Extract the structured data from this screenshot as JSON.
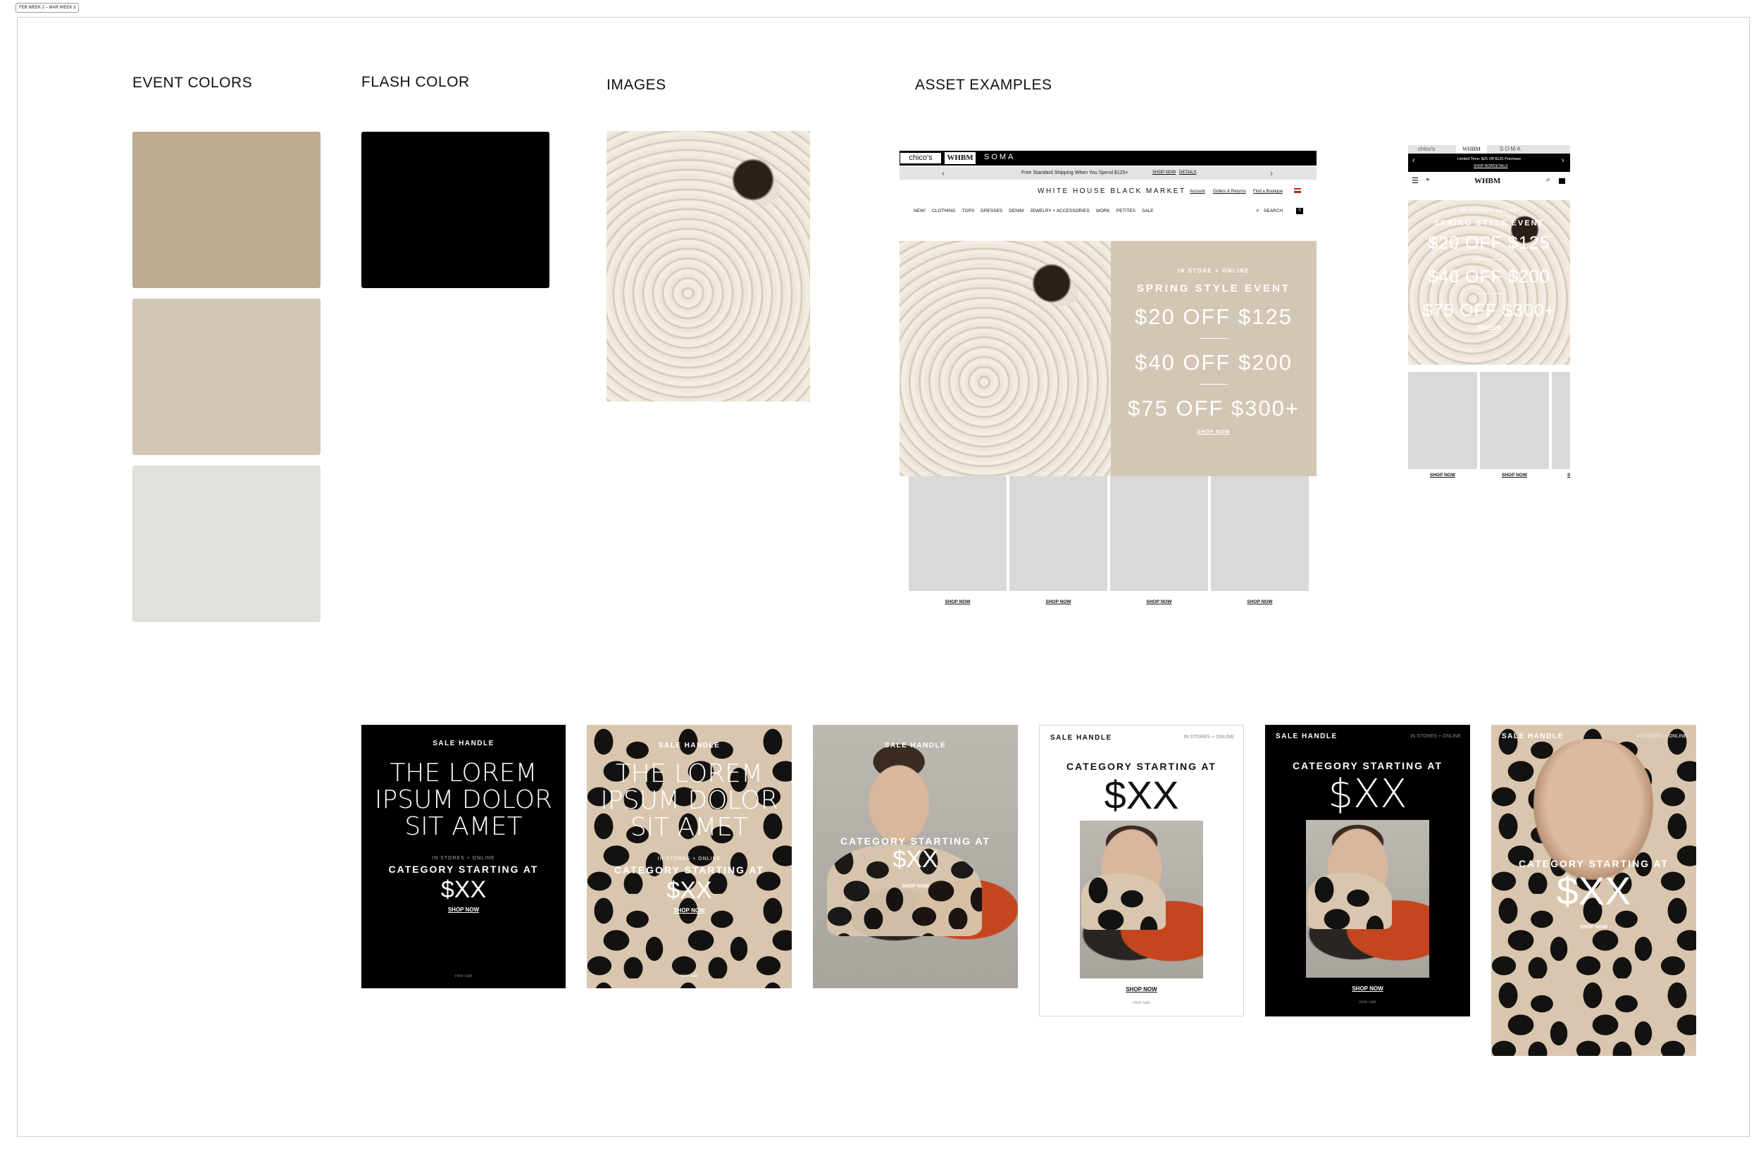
{
  "frame_label": "FEB WEEK 2 – MAR WEEK 3",
  "headings": {
    "event_colors": "EVENT COLORS",
    "flash_color": "FLASH COLOR",
    "images": "IMAGES",
    "asset_examples": "ASSET EXAMPLES"
  },
  "colors": {
    "event": [
      "#BEAB92",
      "#D4C6B4",
      "#E0E0DC"
    ],
    "flash": "#000000"
  },
  "desktop": {
    "brand_tabs": [
      "chico's",
      "WHBM",
      "SOMA"
    ],
    "promo_bar": "Free Standard Shipping When You Spend $125+",
    "promo_links": [
      "SHOP NOW",
      "DETAILS"
    ],
    "logo": "WHITE HOUSE BLACK MARKET",
    "util_links": [
      "Account",
      "Orders & Returns",
      "Find a Boutique"
    ],
    "nav": [
      "NEW!",
      "CLOTHING",
      "TOPS",
      "DRESSES",
      "DENIM",
      "JEWELRY + ACCESSORIES",
      "WORK",
      "PETITES",
      "SALE"
    ],
    "search": "SEARCH",
    "cart_count": "0",
    "hero": {
      "eyebrow": "IN STORE + ONLINE",
      "title": "SPRING STYLE EVENT",
      "offers": [
        "$20 OFF $125",
        "$40 OFF $200",
        "$75 OFF $300+"
      ],
      "cta": "SHOP NOW"
    },
    "tiles_cta": [
      "SHOP NOW",
      "SHOP NOW",
      "SHOP NOW",
      "SHOP NOW"
    ]
  },
  "mobile": {
    "brand_tabs": [
      "chico's",
      "WHBM",
      "SOMA"
    ],
    "promo_bar": "Limited Time: $25 Off $125 Purchase",
    "promo_links": [
      "SHOP NOW",
      "DETAILS"
    ],
    "logo": "WHBM",
    "hero": {
      "eyebrow": "IN STORE + ONLINE",
      "title": "SPRING STYLE EVENT",
      "offers": [
        "$20 OFF $125",
        "$40 OFF $200",
        "$75 OFF $300+"
      ],
      "cta": "SHOP NOW"
    },
    "tiles_cta": [
      "SHOP NOW",
      "SHOP NOW",
      "S"
    ]
  },
  "cards": [
    {
      "handle": "SALE HANDLE",
      "headline": [
        "THE LOREM",
        "IPSUM DOLOR",
        "SIT AMET"
      ],
      "eyebrow": "IN STORES + ONLINE",
      "category": "CATEGORY STARTING AT",
      "price": "$XX",
      "cta": "SHOP NOW",
      "fine": "view sale"
    },
    {
      "handle": "SALE HANDLE",
      "headline": [
        "THE LOREM",
        "IPSUM DOLOR",
        "SIT AMET"
      ],
      "eyebrow": "IN STORES + ONLINE",
      "category": "CATEGORY STARTING AT",
      "price": "$XX",
      "cta": "SHOP NOW",
      "fine": "view sale"
    },
    {
      "handle": "SALE HANDLE",
      "category": "CATEGORY STARTING AT",
      "price": "$XX",
      "cta": "SHOP NOW"
    },
    {
      "handle": "SALE HANDLE",
      "meta": "IN STORES + ONLINE",
      "category": "CATEGORY STARTING AT",
      "price": "$XX",
      "cta": "SHOP NOW",
      "fine": "view sale"
    },
    {
      "handle": "SALE HANDLE",
      "meta": "IN STORES + ONLINE",
      "category": "CATEGORY STARTING AT",
      "price": "$XX",
      "cta": "SHOP NOW",
      "fine": "view sale"
    },
    {
      "handle": "SALE HANDLE",
      "meta": "IN STORES + ONLINE",
      "category": "CATEGORY STARTING AT",
      "price": "$XX",
      "cta": "SHOP NOW"
    }
  ]
}
